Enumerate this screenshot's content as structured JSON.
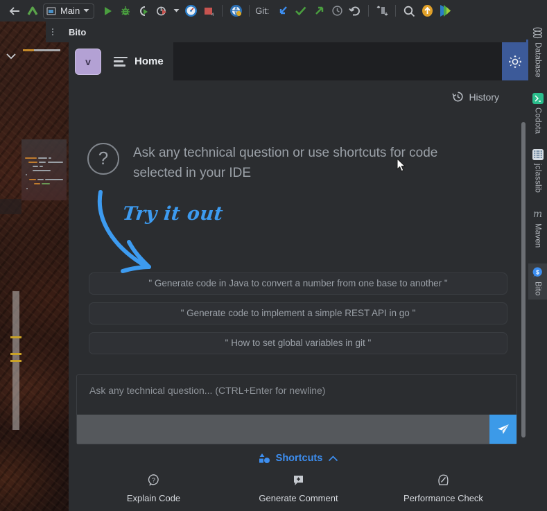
{
  "toolbar": {
    "run_config": "Main",
    "git_label": "Git:",
    "icons": [
      "back-arrow-icon",
      "branch-up-icon",
      "run-config-icon",
      "chevron-down-icon",
      "run-icon",
      "debug-icon",
      "coverage-icon",
      "profiler-icon",
      "profiler-dropdown-icon",
      "dashboard-icon",
      "stop-icon",
      "remote-dev-icon",
      "git-update-icon",
      "git-commit-icon",
      "git-push-icon",
      "git-history-icon",
      "git-rollback-icon",
      "diff-icon",
      "search-icon",
      "upload-icon",
      "play-gradient-icon"
    ]
  },
  "tool_window": {
    "title": "Bito",
    "options_icon": "more-options-icon"
  },
  "panel": {
    "avatar_initial": "v",
    "menu_icon": "hamburger-icon",
    "page_title": "Home",
    "settings_icon": "gear-icon",
    "history": {
      "icon": "history-icon",
      "label": "History"
    },
    "hero": {
      "icon": "question-mark-icon",
      "text": "Ask any technical question or use shortcuts for code selected in your IDE",
      "annotation": "Try it out",
      "annotation_color": "#3d9bf0",
      "arrow_icon": "curved-arrow-down-icon"
    },
    "suggestions": [
      "\" Generate code in Java to convert a number from one base to another \"",
      "\" Generate code to implement a simple REST API in go \"",
      "\" How to set global variables in git \""
    ],
    "composer": {
      "placeholder": "Ask any technical question... (CTRL+Enter for newline)",
      "value": "",
      "send_icon": "send-paper-plane-icon",
      "send_color": "#3c9ae8"
    },
    "shortcuts": {
      "label": "Shortcuts",
      "icon": "shapes-icon",
      "collapse_icon": "chevron-up-icon",
      "items": [
        {
          "label": "Explain Code",
          "icon": "question-bubble-icon"
        },
        {
          "label": "Generate Comment",
          "icon": "comment-plus-icon"
        },
        {
          "label": "Performance Check",
          "icon": "gauge-icon"
        }
      ]
    }
  },
  "right_bar": {
    "items": [
      {
        "label": "Database",
        "icon": "database-icon",
        "active": false
      },
      {
        "label": "Codota",
        "icon": "codota-icon",
        "active": false
      },
      {
        "label": "jclasslib",
        "icon": "jclasslib-icon",
        "active": false
      },
      {
        "label": "Maven",
        "icon": "maven-icon",
        "active": false
      },
      {
        "label": "Bito",
        "icon": "bito-icon",
        "active": true
      }
    ]
  },
  "colors": {
    "panel_bg": "#2b2d30",
    "header_bg": "#1e1f22",
    "accent_blue": "#3d8ef0",
    "gear_bg": "#3c5a99",
    "avatar": "#b3a1d4"
  }
}
